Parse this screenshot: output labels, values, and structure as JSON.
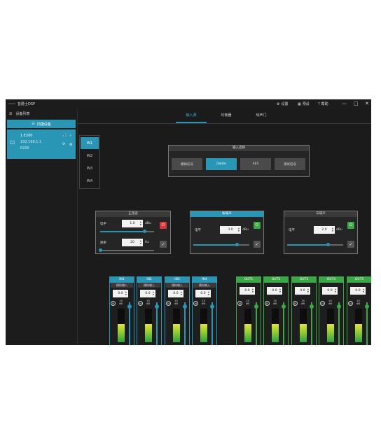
{
  "titlebar": {
    "logo": "xxxxx",
    "title": "音爵士DSP",
    "settings_label": "设置",
    "preset_label": "预设",
    "help_label": "帮助",
    "minimize_glyph": "—",
    "maximize_glyph": "□",
    "close_glyph": "✕"
  },
  "sidebar": {
    "title": "设备列表",
    "scan_button": "扫描设备",
    "device": {
      "name": "1.E200",
      "ip": "192.168.1.1",
      "model": "E200"
    }
  },
  "tabs": [
    {
      "label": "输入源"
    },
    {
      "label": "均衡器"
    },
    {
      "label": "噪声门"
    }
  ],
  "input_list": [
    "IN1",
    "IN2",
    "IN3",
    "IN4"
  ],
  "input_select": {
    "title": "输入选择",
    "options": [
      "模拟信号",
      "Dante",
      "AES",
      "测试信号"
    ],
    "selected": "Dante"
  },
  "pressure_panel": {
    "title": "正弦波",
    "level_label": "电平",
    "level_value": "1.0",
    "level_unit": "dBu",
    "level_fraction": 0.82,
    "freq_label": "频率",
    "freq_value": "20",
    "freq_unit": "Hz",
    "freq_fraction": 0.0
  },
  "pink_panel": {
    "title": "粉噪声",
    "level_label": "电平",
    "level_value": "3.0",
    "level_unit": "dBu",
    "level_fraction": 0.78
  },
  "white_panel": {
    "title": "白噪声",
    "level_label": "电平",
    "level_value": "2.0",
    "level_unit": "dBu",
    "level_fraction": 0.72
  },
  "strip_q_value": "15",
  "strip_q_label": "dB",
  "strip_m_label": "M",
  "input_strips": [
    {
      "name": "IN1",
      "source": "模拟输入",
      "value": "0.0",
      "min": "-60",
      "level": 0.55,
      "fader": 0.9
    },
    {
      "name": "IN2",
      "source": "模拟输入",
      "value": "0.0",
      "min": "-60",
      "level": 0.55,
      "fader": 0.9
    },
    {
      "name": "IN3",
      "source": "模拟输入",
      "value": "0.0",
      "min": "-60",
      "level": 0.55,
      "fader": 0.9
    },
    {
      "name": "IN4",
      "source": "模拟输入",
      "value": "0.0",
      "min": "-60",
      "level": 0.55,
      "fader": 0.9
    }
  ],
  "output_strips": [
    {
      "name": "OUT1",
      "value": "0.0",
      "min": "-60",
      "level": 0.55,
      "fader": 0.9
    },
    {
      "name": "OUT2",
      "value": "0.0",
      "min": "-60",
      "level": 0.55,
      "fader": 0.9
    },
    {
      "name": "OUT3",
      "value": "0.0",
      "min": "-60",
      "level": 0.55,
      "fader": 0.9
    },
    {
      "name": "OUT4",
      "value": "0.0",
      "min": "-60",
      "level": 0.55,
      "fader": 0.9
    },
    {
      "name": "OUT5",
      "value": "0.0",
      "min": "-60",
      "level": 0.55,
      "fader": 0.9
    }
  ],
  "colors": {
    "accent": "#2a96b6",
    "output_accent": "#3aa845",
    "power_off": "#dd3333"
  }
}
